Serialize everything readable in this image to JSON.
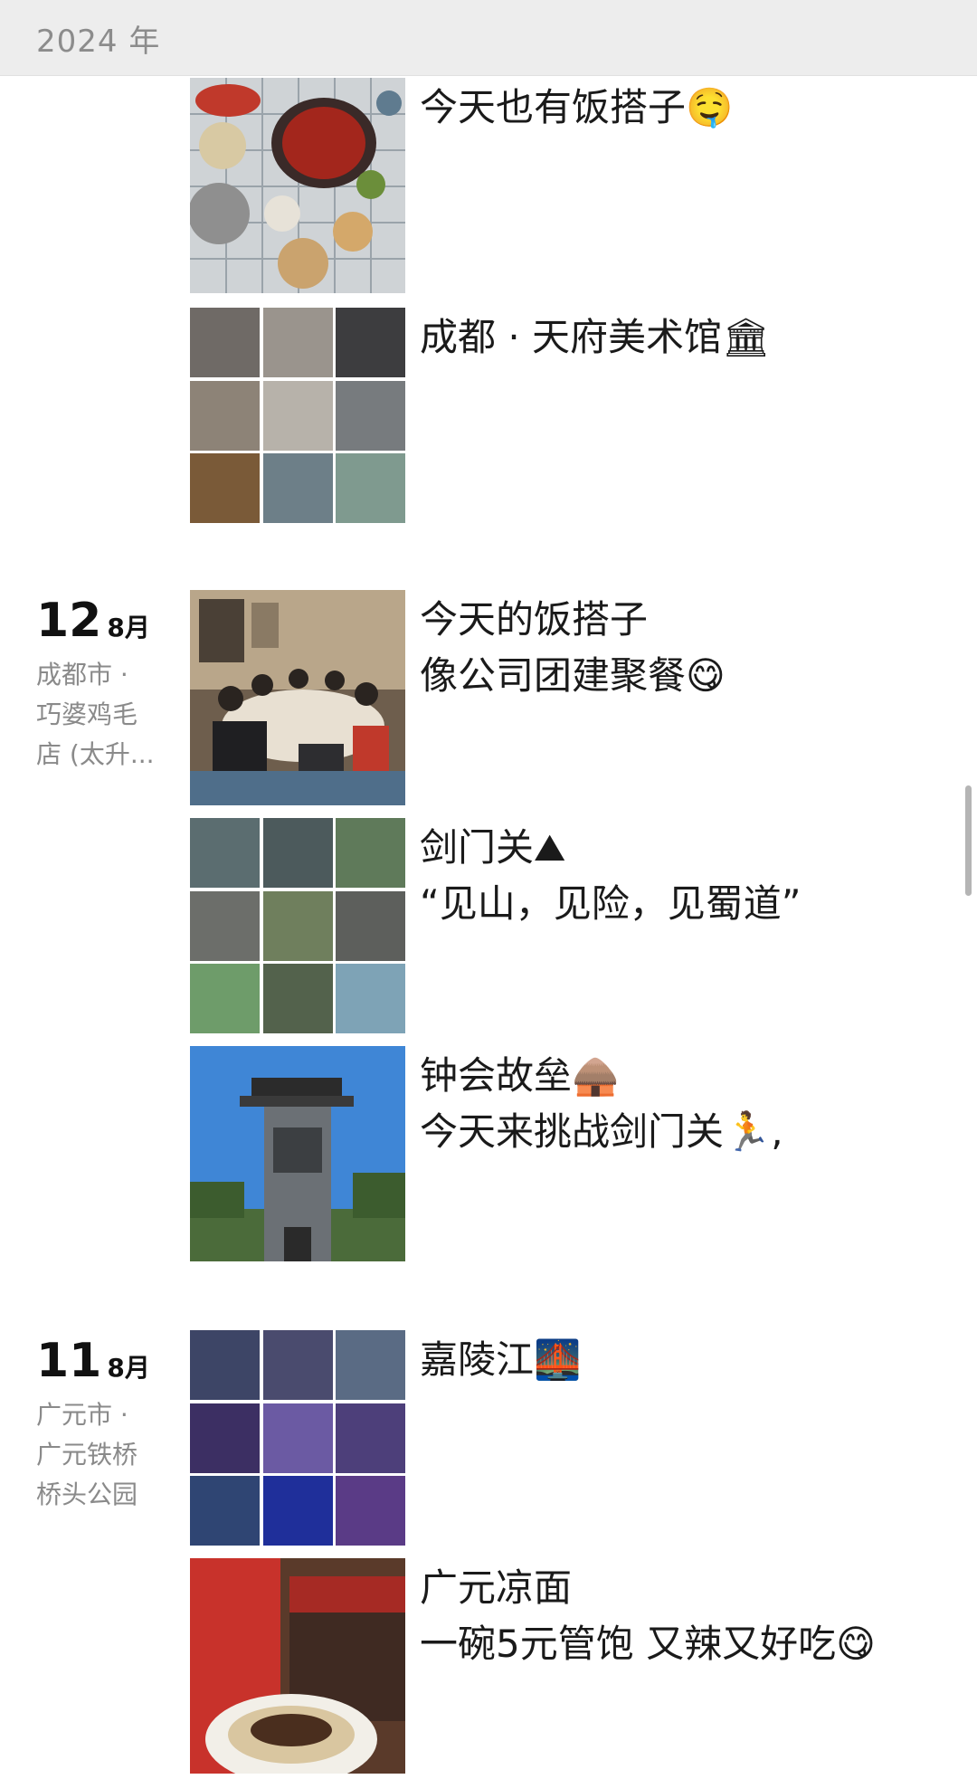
{
  "header": {
    "year": "2024 年"
  },
  "groups": [
    {
      "posts": [
        {
          "caption1": "今天也有饭搭子🤤",
          "caption2": ""
        },
        {
          "caption1": "成都 · 天府美术馆🏛",
          "caption2": ""
        }
      ]
    },
    {
      "day": "12",
      "month": "8月",
      "location": [
        "成都市 ·",
        "巧婆鸡毛",
        "店 (太升..."
      ],
      "posts": [
        {
          "caption1": "今天的饭搭子",
          "caption2": "像公司团建聚餐😋"
        },
        {
          "caption1": "剑门关⛰",
          "caption2": "“见山，见险，见蜀道”"
        },
        {
          "caption1": "钟会故垒🛖",
          "caption2": "今天来挑战剑门关🏃,"
        }
      ]
    },
    {
      "day": "11",
      "month": "8月",
      "location": [
        "广元市 ·",
        "广元铁桥",
        "桥头公园"
      ],
      "posts": [
        {
          "caption1": "嘉陵江🌉",
          "caption2": ""
        },
        {
          "caption1": "广元凉面",
          "caption2": "一碗5元管饱 又辣又好吃😋"
        }
      ]
    }
  ]
}
